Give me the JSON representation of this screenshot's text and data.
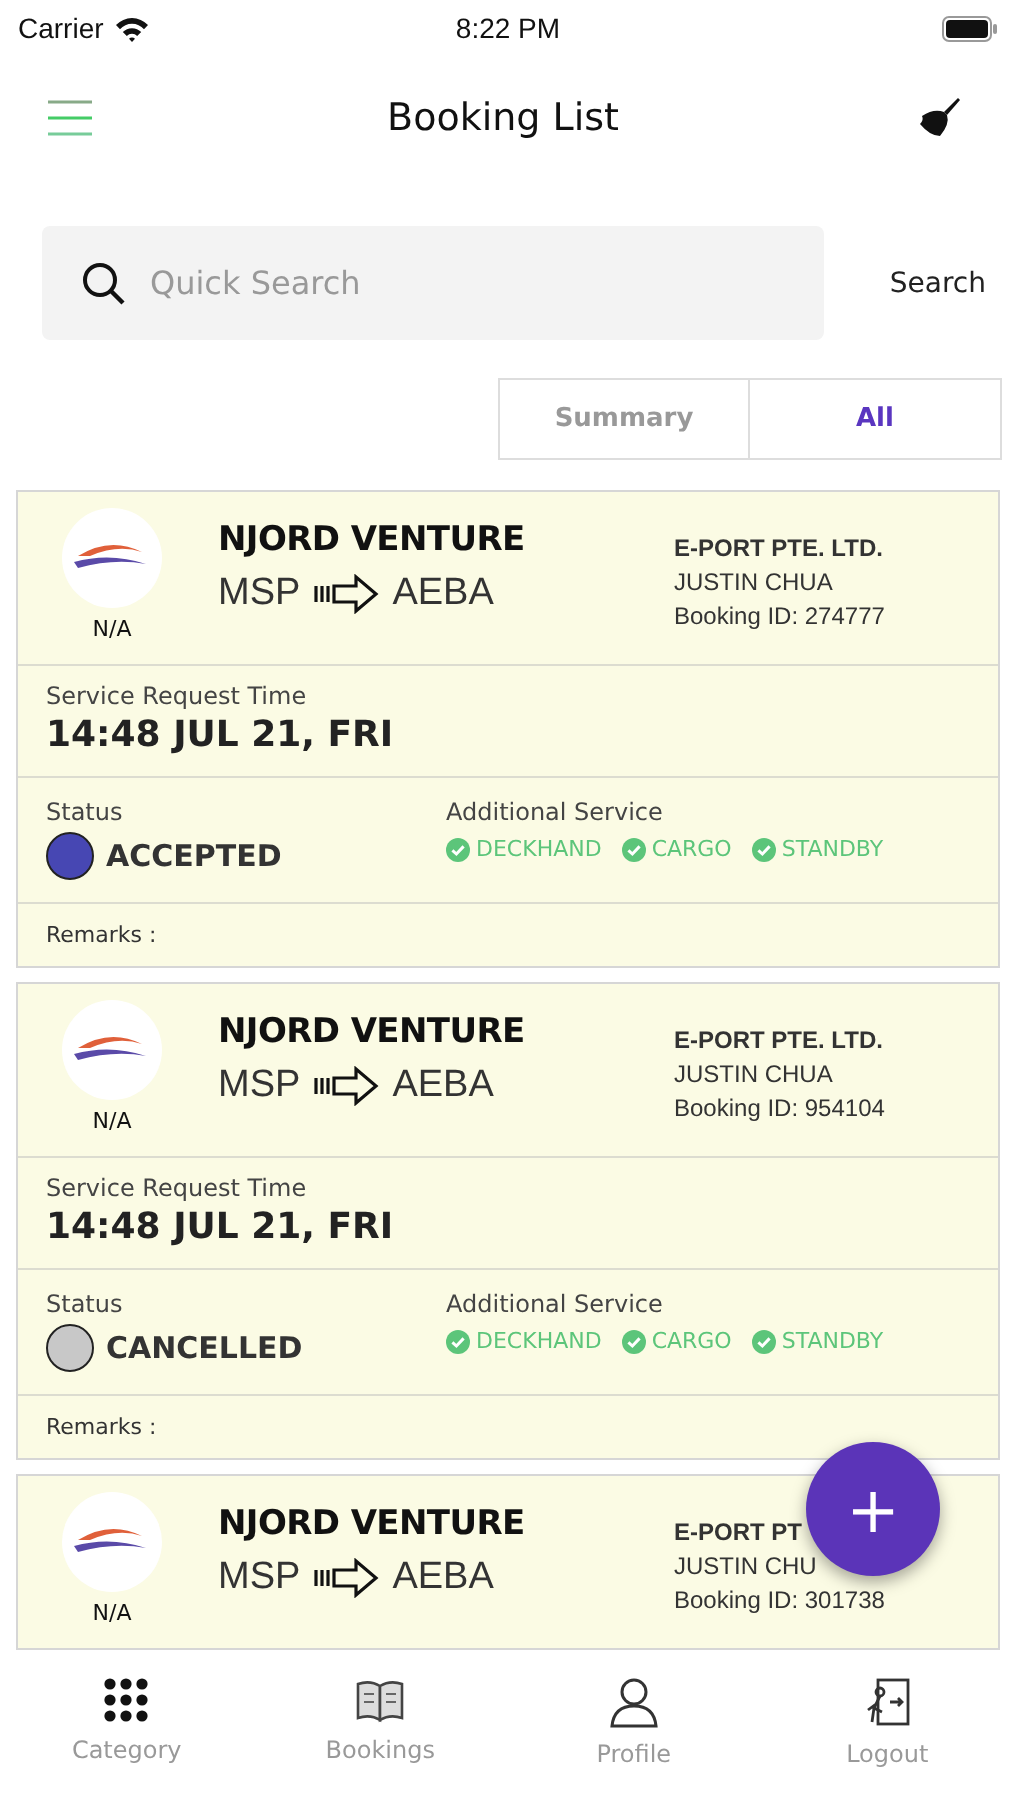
{
  "status_bar": {
    "carrier": "Carrier",
    "time": "8:22 PM"
  },
  "header": {
    "title": "Booking List"
  },
  "search": {
    "placeholder": "Quick Search",
    "button": "Search"
  },
  "segments": [
    {
      "label": "Summary",
      "selected": false
    },
    {
      "label": "All",
      "selected": true
    }
  ],
  "bookings": [
    {
      "vessel": "NJORD VENTURE",
      "logo_caption": "N/A",
      "from": "MSP",
      "to": "AEBA",
      "company": "E-PORT PTE. LTD.",
      "contact": "JUSTIN CHUA",
      "booking_id": "Booking ID: 274777",
      "time_label": "Service Request Time",
      "time": "14:48 JUL 21, FRI",
      "status_label": "Status",
      "status": "ACCEPTED",
      "color": "#4747b3",
      "services_label": "Additional Service",
      "services": [
        "DECKHAND",
        "CARGO",
        "STANDBY"
      ],
      "remarks": "Remarks :"
    },
    {
      "vessel": "NJORD VENTURE",
      "logo_caption": "N/A",
      "from": "MSP",
      "to": "AEBA",
      "company": "E-PORT PTE. LTD.",
      "contact": "JUSTIN CHUA",
      "booking_id": "Booking ID: 954104",
      "time_label": "Service Request Time",
      "time": "14:48 JUL 21, FRI",
      "status_label": "Status",
      "status": "CANCELLED",
      "color": "#c8c8c8",
      "services_label": "Additional Service",
      "services": [
        "DECKHAND",
        "CARGO",
        "STANDBY"
      ],
      "remarks": "Remarks :"
    },
    {
      "vessel": "NJORD VENTURE",
      "logo_caption": "N/A",
      "from": "MSP",
      "to": "AEBA",
      "company": "E-PORT PT",
      "contact": "JUSTIN CHU",
      "booking_id": "Booking ID: 301738"
    }
  ],
  "fab": {
    "label": "+"
  },
  "tab_bar": [
    {
      "kind": "grid",
      "label": "Category"
    },
    {
      "kind": "book",
      "label": "Bookings"
    },
    {
      "kind": "person",
      "label": "Profile"
    },
    {
      "kind": "door",
      "label": "Logout"
    }
  ]
}
